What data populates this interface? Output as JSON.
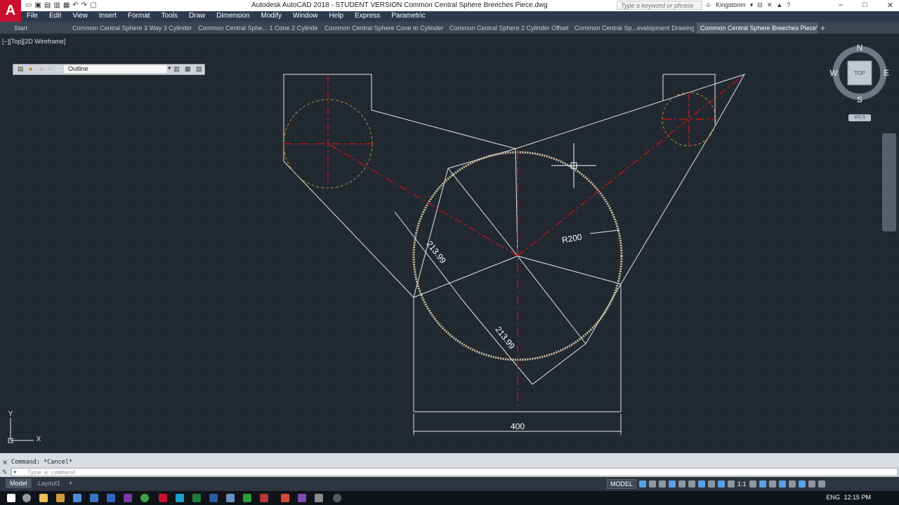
{
  "app": {
    "title": "Autodesk AutoCAD 2018 - STUDENT VERSION    Common Central Sphere Breeches Piece.dwg",
    "logo_letter": "A",
    "search_placeholder": "Type a keyword or phrase",
    "user": "Kingstonm"
  },
  "menu": [
    "File",
    "Edit",
    "View",
    "Insert",
    "Format",
    "Tools",
    "Draw",
    "Dimension",
    "Modify",
    "Window",
    "Help",
    "Express",
    "Parametric"
  ],
  "tabs": [
    {
      "label": "Start"
    },
    {
      "label": "Common Central Sphere 3 Way 3 Cylinders"
    },
    {
      "label": "Common Central Sphe... 1 Cone 2 Cylinders"
    },
    {
      "label": "Common Central Sphere Cone to Cylinder*"
    },
    {
      "label": "Common Central Sphere 2 Cylinder Offset*"
    },
    {
      "label": "Common Central Sp...evelopment Drawing"
    },
    {
      "label": "Common Central Sphere Breeches Piece*"
    }
  ],
  "viewport": {
    "controls": "[−][Top][2D Wireframe]",
    "layer_name": "Outline"
  },
  "viewcube": {
    "n": "N",
    "s": "S",
    "e": "E",
    "w": "W",
    "face": "TOP",
    "wcs": "WCS"
  },
  "dimensions": {
    "radius": "R200",
    "aligned_1": "213.99",
    "aligned_2": "213.99",
    "linear": "400"
  },
  "ucs": {
    "x": "X",
    "y": "Y"
  },
  "command": {
    "history": "Command: *Cancel*",
    "placeholder": "Type a command"
  },
  "layout_tabs": [
    "Model",
    "Layout1"
  ],
  "status": {
    "model": "MODEL",
    "scale": "1:1"
  },
  "taskbar": {
    "lang": "ENG",
    "time": "12:15 PM"
  },
  "colors": {
    "background": "#212830",
    "outline": "#e6e6e6",
    "centerline": "#d01818",
    "hidden_circle": "#c98a3c",
    "sphere": "#d9c2a4"
  }
}
